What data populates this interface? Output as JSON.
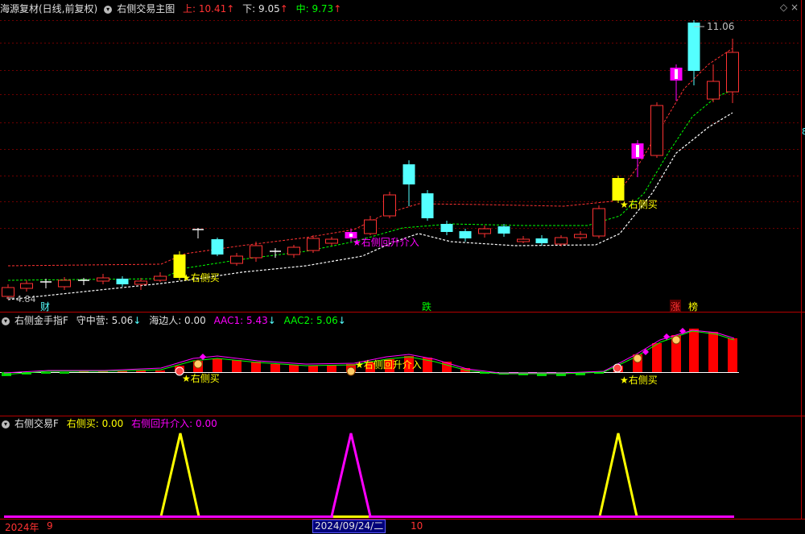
{
  "main": {
    "stock": "海源复材(日线,前复权)",
    "indicator": "右侧交易主图",
    "upper_label": "上: 10.41",
    "lower_label": "下: 9.05",
    "mid_label": "中: 9.73",
    "high_value": "11.06",
    "low_value": "4.84",
    "signal_buy": "★右侧买",
    "signal_rise": "★右侧回升介入",
    "tag_cai": "财",
    "tag_die": "跌",
    "tag_zhang": "涨",
    "tag_bang": "榜",
    "right_edge": "8",
    "colors": {
      "upper": "#ff3232",
      "lower": "#00ff00",
      "mid": "#00ff00",
      "up_candle": "#ff3232",
      "down_candle": "#54ffff",
      "yellow": "#ffff00",
      "magenta": "#ff00ff"
    }
  },
  "panel2": {
    "title": "右侧金手指F",
    "v1": "守中营: 5.06",
    "v2": "海边人: 0.00",
    "v3": "AAC1: 5.43",
    "v4": "AAC2: 5.06",
    "signal_buy": "★右侧买",
    "signal_rise": "★右侧回升介入"
  },
  "panel3": {
    "title": "右侧交易F",
    "v1": "右侧买: 0.00",
    "v2": "右侧回升介入: 0.00"
  },
  "axis": {
    "year": "2024年",
    "m9": "9",
    "selected_date": "2024/09/24/二",
    "m10": "10"
  }
}
